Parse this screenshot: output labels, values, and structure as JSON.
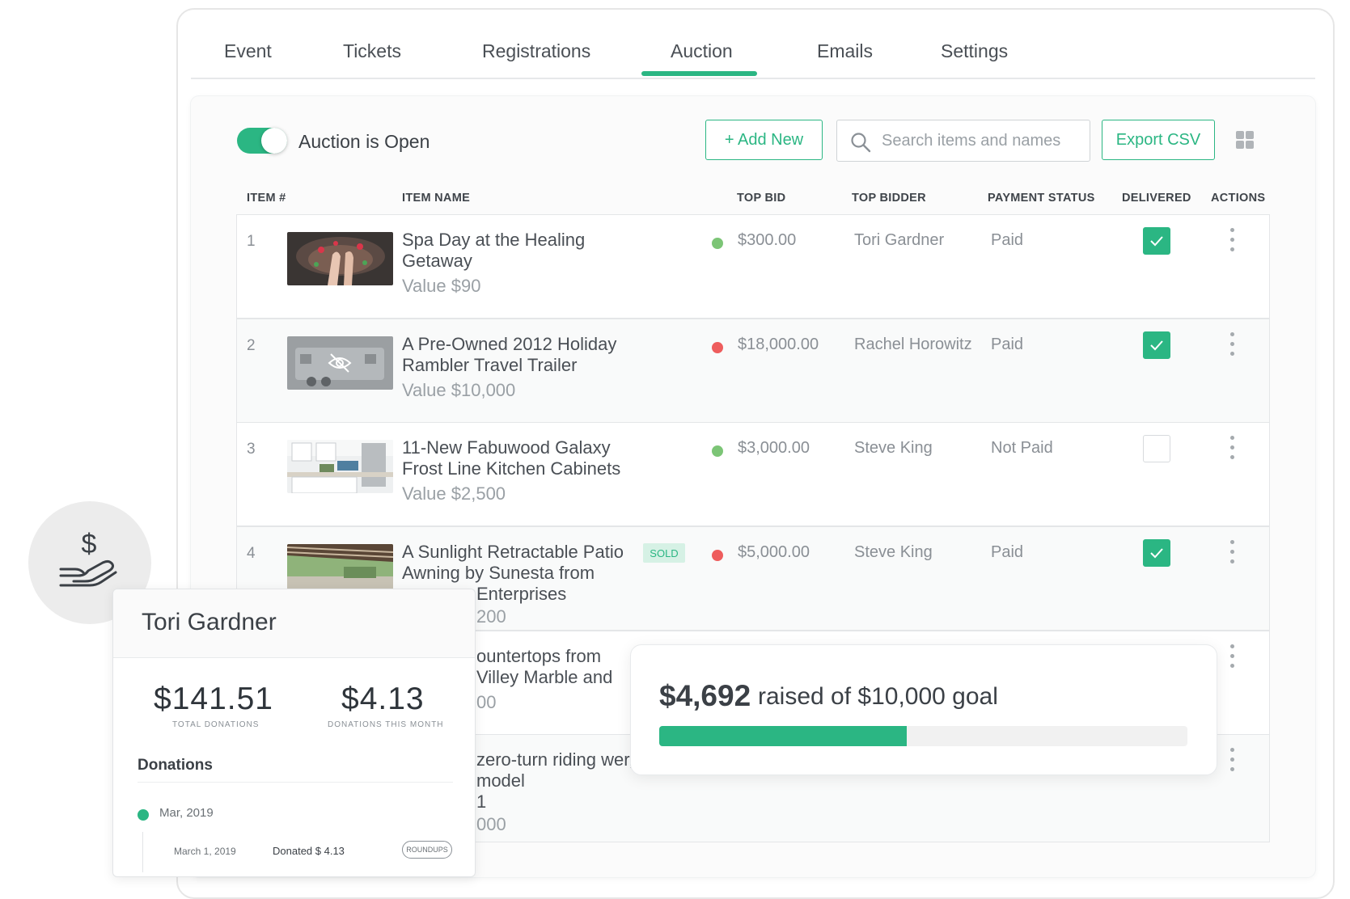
{
  "tabs": [
    {
      "label": "Event"
    },
    {
      "label": "Tickets"
    },
    {
      "label": "Registrations"
    },
    {
      "label": "Auction"
    },
    {
      "label": "Emails"
    },
    {
      "label": "Settings"
    }
  ],
  "active_tab": "Auction",
  "toolbar": {
    "toggle_label": "Auction is Open",
    "toggle_on": true,
    "add_label": "+ Add New",
    "search_placeholder": "Search items and names",
    "export_label": "Export CSV"
  },
  "columns": {
    "item_num": "ITEM #",
    "item_name": "ITEM NAME",
    "top_bid": "TOP BID",
    "top_bidder": "TOP BIDDER",
    "payment_status": "PAYMENT STATUS",
    "delivered": "DELIVERED",
    "actions": "ACTIONS"
  },
  "rows": [
    {
      "num": "1",
      "name": "Spa Day at the Healing Getaway",
      "value": "Value $90",
      "bid": "$300.00",
      "dot": "#7cc576",
      "bidder": "Tori Gardner",
      "status": "Paid",
      "delivered": true,
      "sold": ""
    },
    {
      "num": "2",
      "name": "A Pre-Owned 2012 Holiday Rambler Travel Trailer",
      "value": "Value $10,000",
      "bid": "$18,000.00",
      "dot": "#ee5d5d",
      "bidder": "Rachel Horowitz",
      "status": "Paid",
      "delivered": true,
      "sold": ""
    },
    {
      "num": "3",
      "name": "11-New Fabuwood Galaxy Frost Line Kitchen Cabinets",
      "value": "Value $2,500",
      "bid": "$3,000.00",
      "dot": "#7cc576",
      "bidder": "Steve King",
      "status": "Not Paid",
      "delivered": false,
      "sold": ""
    },
    {
      "num": "4",
      "name": "A Sunlight Retractable Patio Awning by Sunesta from",
      "name_line3": "Enterprises",
      "value": "200",
      "bid": "$5,000.00",
      "dot": "#ee5d5d",
      "bidder": "Steve King",
      "status": "Paid",
      "delivered": true,
      "sold": "SOLD"
    },
    {
      "num": "",
      "name": "ountertops from Villey Marble and",
      "value": "00"
    },
    {
      "num": "",
      "name": "zero-turn riding wer, model",
      "name_line3": "1",
      "value": "000"
    }
  ],
  "donor_card": {
    "name": "Tori Gardner",
    "total": "$141.51",
    "total_label": "TOTAL DONATIONS",
    "month": "$4.13",
    "month_label": "DONATIONS THIS MONTH",
    "donations_title": "Donations",
    "group_label": "Mar, 2019",
    "entry_date": "March 1, 2019",
    "entry_amount": "Donated $ 4.13",
    "entry_tag": "ROUNDUPS"
  },
  "goal": {
    "raised": "$4,692",
    "text": "raised of $10,000 goal",
    "progress": 0.4692,
    "accent": "#2bb683"
  },
  "icons": [
    "search-icon",
    "grid-view-icon",
    "kebab-menu-icon",
    "checkmark-icon",
    "hand-dollar-icon"
  ]
}
